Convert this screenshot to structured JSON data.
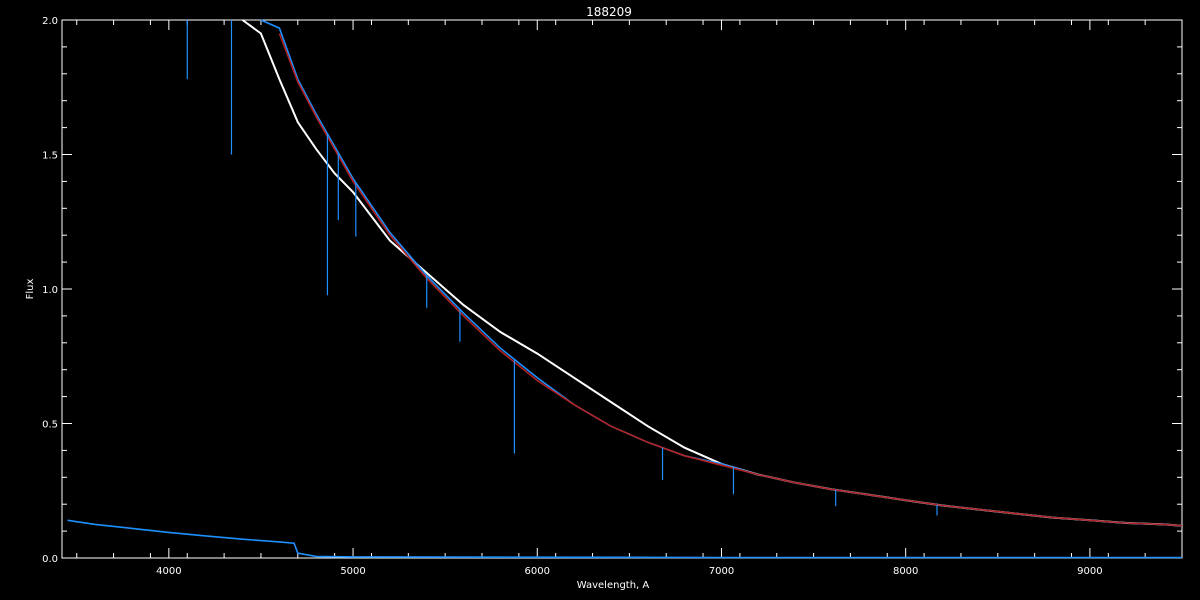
{
  "chart_data": {
    "type": "line",
    "title": "188209",
    "xlabel": "Wavelength, A",
    "ylabel": "Flux",
    "xlim": [
      3420,
      9500
    ],
    "ylim": [
      0.0,
      2.0
    ],
    "x_ticks": [
      4000,
      5000,
      6000,
      7000,
      8000,
      9000
    ],
    "x_tick_labels": [
      "4000",
      "5000",
      "6000",
      "7000",
      "8000",
      "9000"
    ],
    "y_ticks": [
      0.0,
      0.5,
      1.0,
      1.5,
      2.0
    ],
    "y_tick_labels": [
      "0.0",
      "0.5",
      "1.0",
      "1.5",
      "2.0"
    ],
    "grid": false,
    "background": "#000000",
    "series": [
      {
        "color": "#ffffff",
        "x": [
          4400,
          4500,
          4600,
          4700,
          4800,
          4900,
          5000,
          5200,
          5400,
          5600,
          5800,
          6000,
          6200,
          6400,
          6600,
          6800,
          7000,
          7200,
          7400,
          7600,
          7800,
          8000,
          8200,
          8400,
          8600,
          8800,
          9000,
          9200,
          9400,
          9500
        ],
        "y": [
          2.0,
          1.95,
          1.78,
          1.62,
          1.52,
          1.43,
          1.36,
          1.18,
          1.06,
          0.94,
          0.84,
          0.76,
          0.67,
          0.58,
          0.49,
          0.41,
          0.35,
          0.31,
          0.28,
          0.255,
          0.235,
          0.215,
          0.195,
          0.18,
          0.165,
          0.15,
          0.14,
          0.13,
          0.125,
          0.12
        ]
      },
      {
        "color": "#1e90ff",
        "x": [
          4500,
          4600,
          4700,
          4800,
          4900,
          5000,
          5200,
          5400,
          5600,
          5800,
          6000,
          6200,
          6400,
          6600,
          6800,
          7000,
          7200,
          7400,
          7600,
          7800,
          8000,
          8200,
          8400,
          8600,
          8800,
          9000,
          9200,
          9400,
          9500
        ],
        "y": [
          2.0,
          1.97,
          1.78,
          1.65,
          1.53,
          1.41,
          1.21,
          1.05,
          0.91,
          0.78,
          0.67,
          0.57,
          0.49,
          0.43,
          0.38,
          0.35,
          0.31,
          0.28,
          0.255,
          0.235,
          0.215,
          0.195,
          0.18,
          0.165,
          0.15,
          0.14,
          0.13,
          0.125,
          0.12
        ]
      },
      {
        "color": "#b22222",
        "x": [
          4600,
          4700,
          4800,
          4900,
          5000,
          5200,
          5400,
          5600,
          5800,
          6000,
          6200,
          6400,
          6600,
          6800,
          7000,
          7200,
          7400,
          7600,
          7800,
          8000,
          8200,
          8400,
          8600,
          8800,
          9000,
          9200,
          9400,
          9500
        ],
        "y": [
          1.95,
          1.77,
          1.64,
          1.52,
          1.4,
          1.2,
          1.04,
          0.9,
          0.77,
          0.66,
          0.57,
          0.49,
          0.43,
          0.38,
          0.345,
          0.31,
          0.28,
          0.255,
          0.235,
          0.215,
          0.195,
          0.18,
          0.165,
          0.15,
          0.14,
          0.13,
          0.125,
          0.12
        ]
      },
      {
        "color": "#1e90ff",
        "x": [
          3450,
          3600,
          3800,
          4000,
          4200,
          4400,
          4600,
          4680,
          4700,
          4800,
          5000,
          6000,
          7000,
          8000,
          9000,
          9500
        ],
        "y": [
          0.14,
          0.125,
          0.11,
          0.095,
          0.082,
          0.07,
          0.06,
          0.055,
          0.018,
          0.006,
          0.004,
          0.003,
          0.002,
          0.002,
          0.002,
          0.002
        ]
      }
    ],
    "absorption_lines": [
      {
        "x": 4100,
        "depth": 0.22,
        "color": "#1e90ff"
      },
      {
        "x": 4340,
        "depth": 0.5,
        "color": "#1e90ff"
      },
      {
        "x": 4861,
        "depth": 0.6,
        "color": "#1e90ff"
      },
      {
        "x": 4920,
        "depth": 0.25,
        "color": "#1e90ff"
      },
      {
        "x": 5015,
        "depth": 0.2,
        "color": "#1e90ff"
      },
      {
        "x": 5400,
        "depth": 0.12,
        "color": "#1e90ff"
      },
      {
        "x": 5580,
        "depth": 0.12,
        "color": "#1e90ff"
      },
      {
        "x": 5876,
        "depth": 0.35,
        "color": "#1e90ff"
      },
      {
        "x": 6680,
        "depth": 0.12,
        "color": "#1e90ff"
      },
      {
        "x": 7065,
        "depth": 0.1,
        "color": "#1e90ff"
      },
      {
        "x": 7620,
        "depth": 0.06,
        "color": "#1e90ff"
      },
      {
        "x": 8170,
        "depth": 0.04,
        "color": "#1e90ff"
      }
    ]
  }
}
